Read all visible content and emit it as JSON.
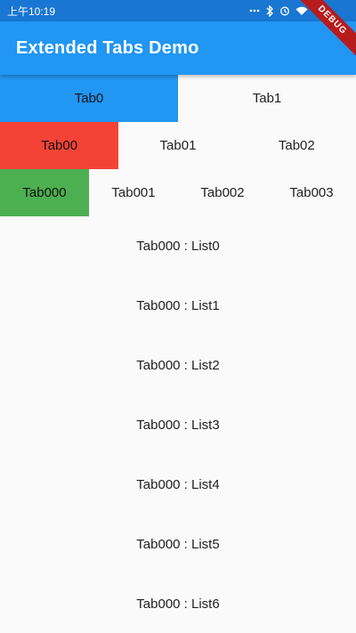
{
  "status_bar": {
    "time": "上午10:19",
    "icons": [
      "dots-icon",
      "bluetooth-icon",
      "alarm-icon",
      "wifi-icon"
    ]
  },
  "debug_banner": "DEBUG",
  "app_bar": {
    "title": "Extended Tabs Demo"
  },
  "tabs_level1": {
    "selected_index": 0,
    "items": [
      "Tab0",
      "Tab1"
    ]
  },
  "tabs_level2": {
    "selected_index": 0,
    "items": [
      "Tab00",
      "Tab01",
      "Tab02"
    ]
  },
  "tabs_level3": {
    "selected_index": 0,
    "items": [
      "Tab000",
      "Tab001",
      "Tab002",
      "Tab003"
    ]
  },
  "list": {
    "items": [
      "Tab000 : List0",
      "Tab000 : List1",
      "Tab000 : List2",
      "Tab000 : List3",
      "Tab000 : List4",
      "Tab000 : List5",
      "Tab000 : List6"
    ]
  },
  "colors": {
    "status_bar": "#1976d2",
    "app_bar": "#2196f3",
    "tab_level1_selected": "#2196f3",
    "tab_level2_selected": "#f44336",
    "tab_level3_selected": "#4caf50",
    "debug_banner": "#b71c1c"
  }
}
